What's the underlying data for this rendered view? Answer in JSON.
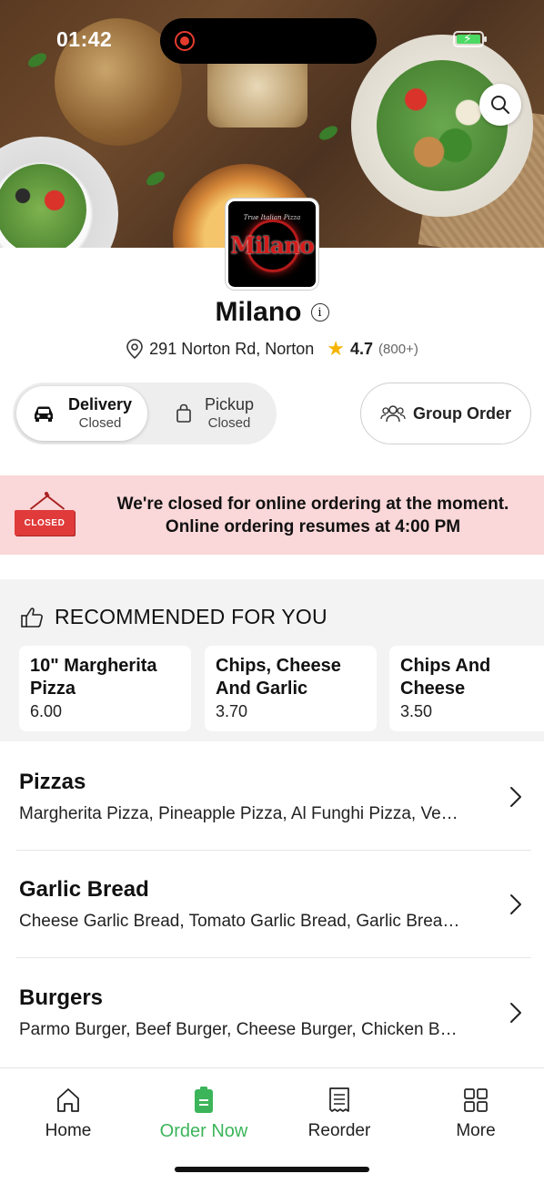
{
  "status_bar": {
    "time": "01:42"
  },
  "restaurant": {
    "logo_text": "Milano",
    "logo_tagline": "True Italian Pizza",
    "name": "Milano",
    "address": "291 Norton Rd, Norton",
    "rating": "4.7",
    "rating_count": "(800+)"
  },
  "order_mode": {
    "delivery": {
      "label": "Delivery",
      "status": "Closed"
    },
    "pickup": {
      "label": "Pickup",
      "status": "Closed"
    },
    "group_order_label": "Group Order"
  },
  "closed_banner": {
    "sign_text": "CLOSED",
    "line1": "We're closed for online ordering at the moment.",
    "line2": "Online ordering resumes at 4:00 PM"
  },
  "recommended": {
    "title": "RECOMMENDED FOR YOU",
    "items": [
      {
        "name_line1": "10\" Margherita",
        "name_line2": "Pizza",
        "price": "6.00"
      },
      {
        "name_line1": "Chips, Cheese",
        "name_line2": "And Garlic",
        "price": "3.70"
      },
      {
        "name_line1": "Chips And",
        "name_line2": "Cheese",
        "price": "3.50"
      }
    ]
  },
  "categories": [
    {
      "name": "Pizzas",
      "description": "Margherita Pizza, Pineapple Pizza, Al Funghi Pizza, Ve…"
    },
    {
      "name": "Garlic Bread",
      "description": "Cheese Garlic Bread, Tomato Garlic Bread, Garlic Brea…"
    },
    {
      "name": "Burgers",
      "description": "Parmo Burger, Beef Burger, Cheese Burger, Chicken B…"
    }
  ],
  "bottom_nav": [
    {
      "label": "Home",
      "icon": "home-icon"
    },
    {
      "label": "Order Now",
      "icon": "order-icon",
      "active": true
    },
    {
      "label": "Reorder",
      "icon": "receipt-icon"
    },
    {
      "label": "More",
      "icon": "grid-icon"
    }
  ],
  "colors": {
    "accent_green": "#3cb55a",
    "closed_banner_bg": "#fad7d8",
    "closed_sign_red": "#e03a3a",
    "star": "#f6b400"
  }
}
